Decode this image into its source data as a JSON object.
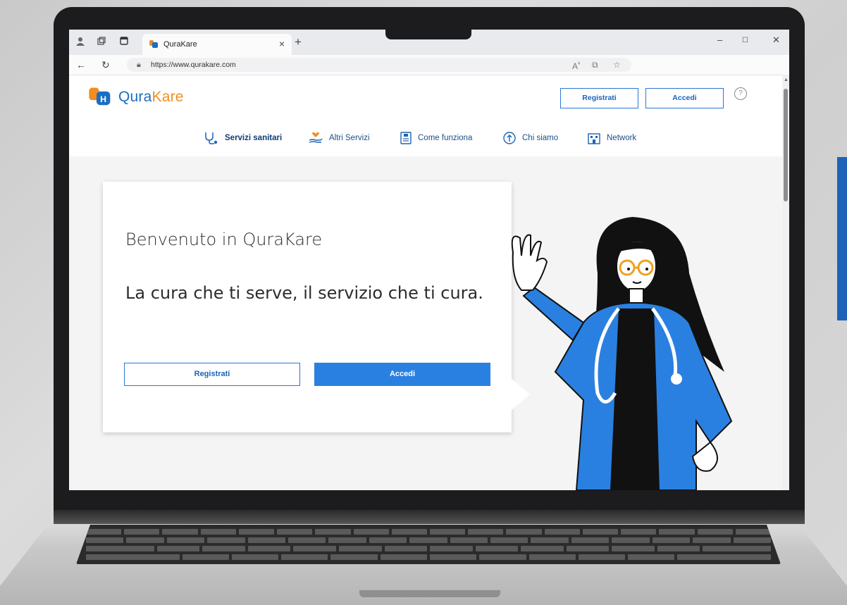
{
  "browser": {
    "tab_title": "QuraKare",
    "url": "https://www.qurakare.com",
    "new_tab_symbol": "+",
    "close_tab_symbol": "×"
  },
  "site": {
    "logo_text_main": "Qura",
    "logo_text_accent": "Kare",
    "brand_blue": "#1b6ec2",
    "brand_orange": "#f28d1f",
    "header": {
      "register_label": "Registrati",
      "login_label": "Accedi",
      "help_symbol": "?"
    },
    "menu": [
      {
        "label": "Servizi sanitari",
        "icon": "stethoscope-icon",
        "active": true
      },
      {
        "label": "Altri Servizi",
        "icon": "hand-heart-icon",
        "active": false
      },
      {
        "label": "Come funziona",
        "icon": "document-icon",
        "active": false
      },
      {
        "label": "Chi siamo",
        "icon": "info-arrow-icon",
        "active": false
      },
      {
        "label": "Network",
        "icon": "building-icon",
        "active": false
      }
    ],
    "hero": {
      "welcome": "Benvenuto in QuraKare",
      "tagline": "La cura che ti serve, il servizio che ti cura.",
      "register_label": "Registrati",
      "login_label": "Accedi"
    }
  }
}
